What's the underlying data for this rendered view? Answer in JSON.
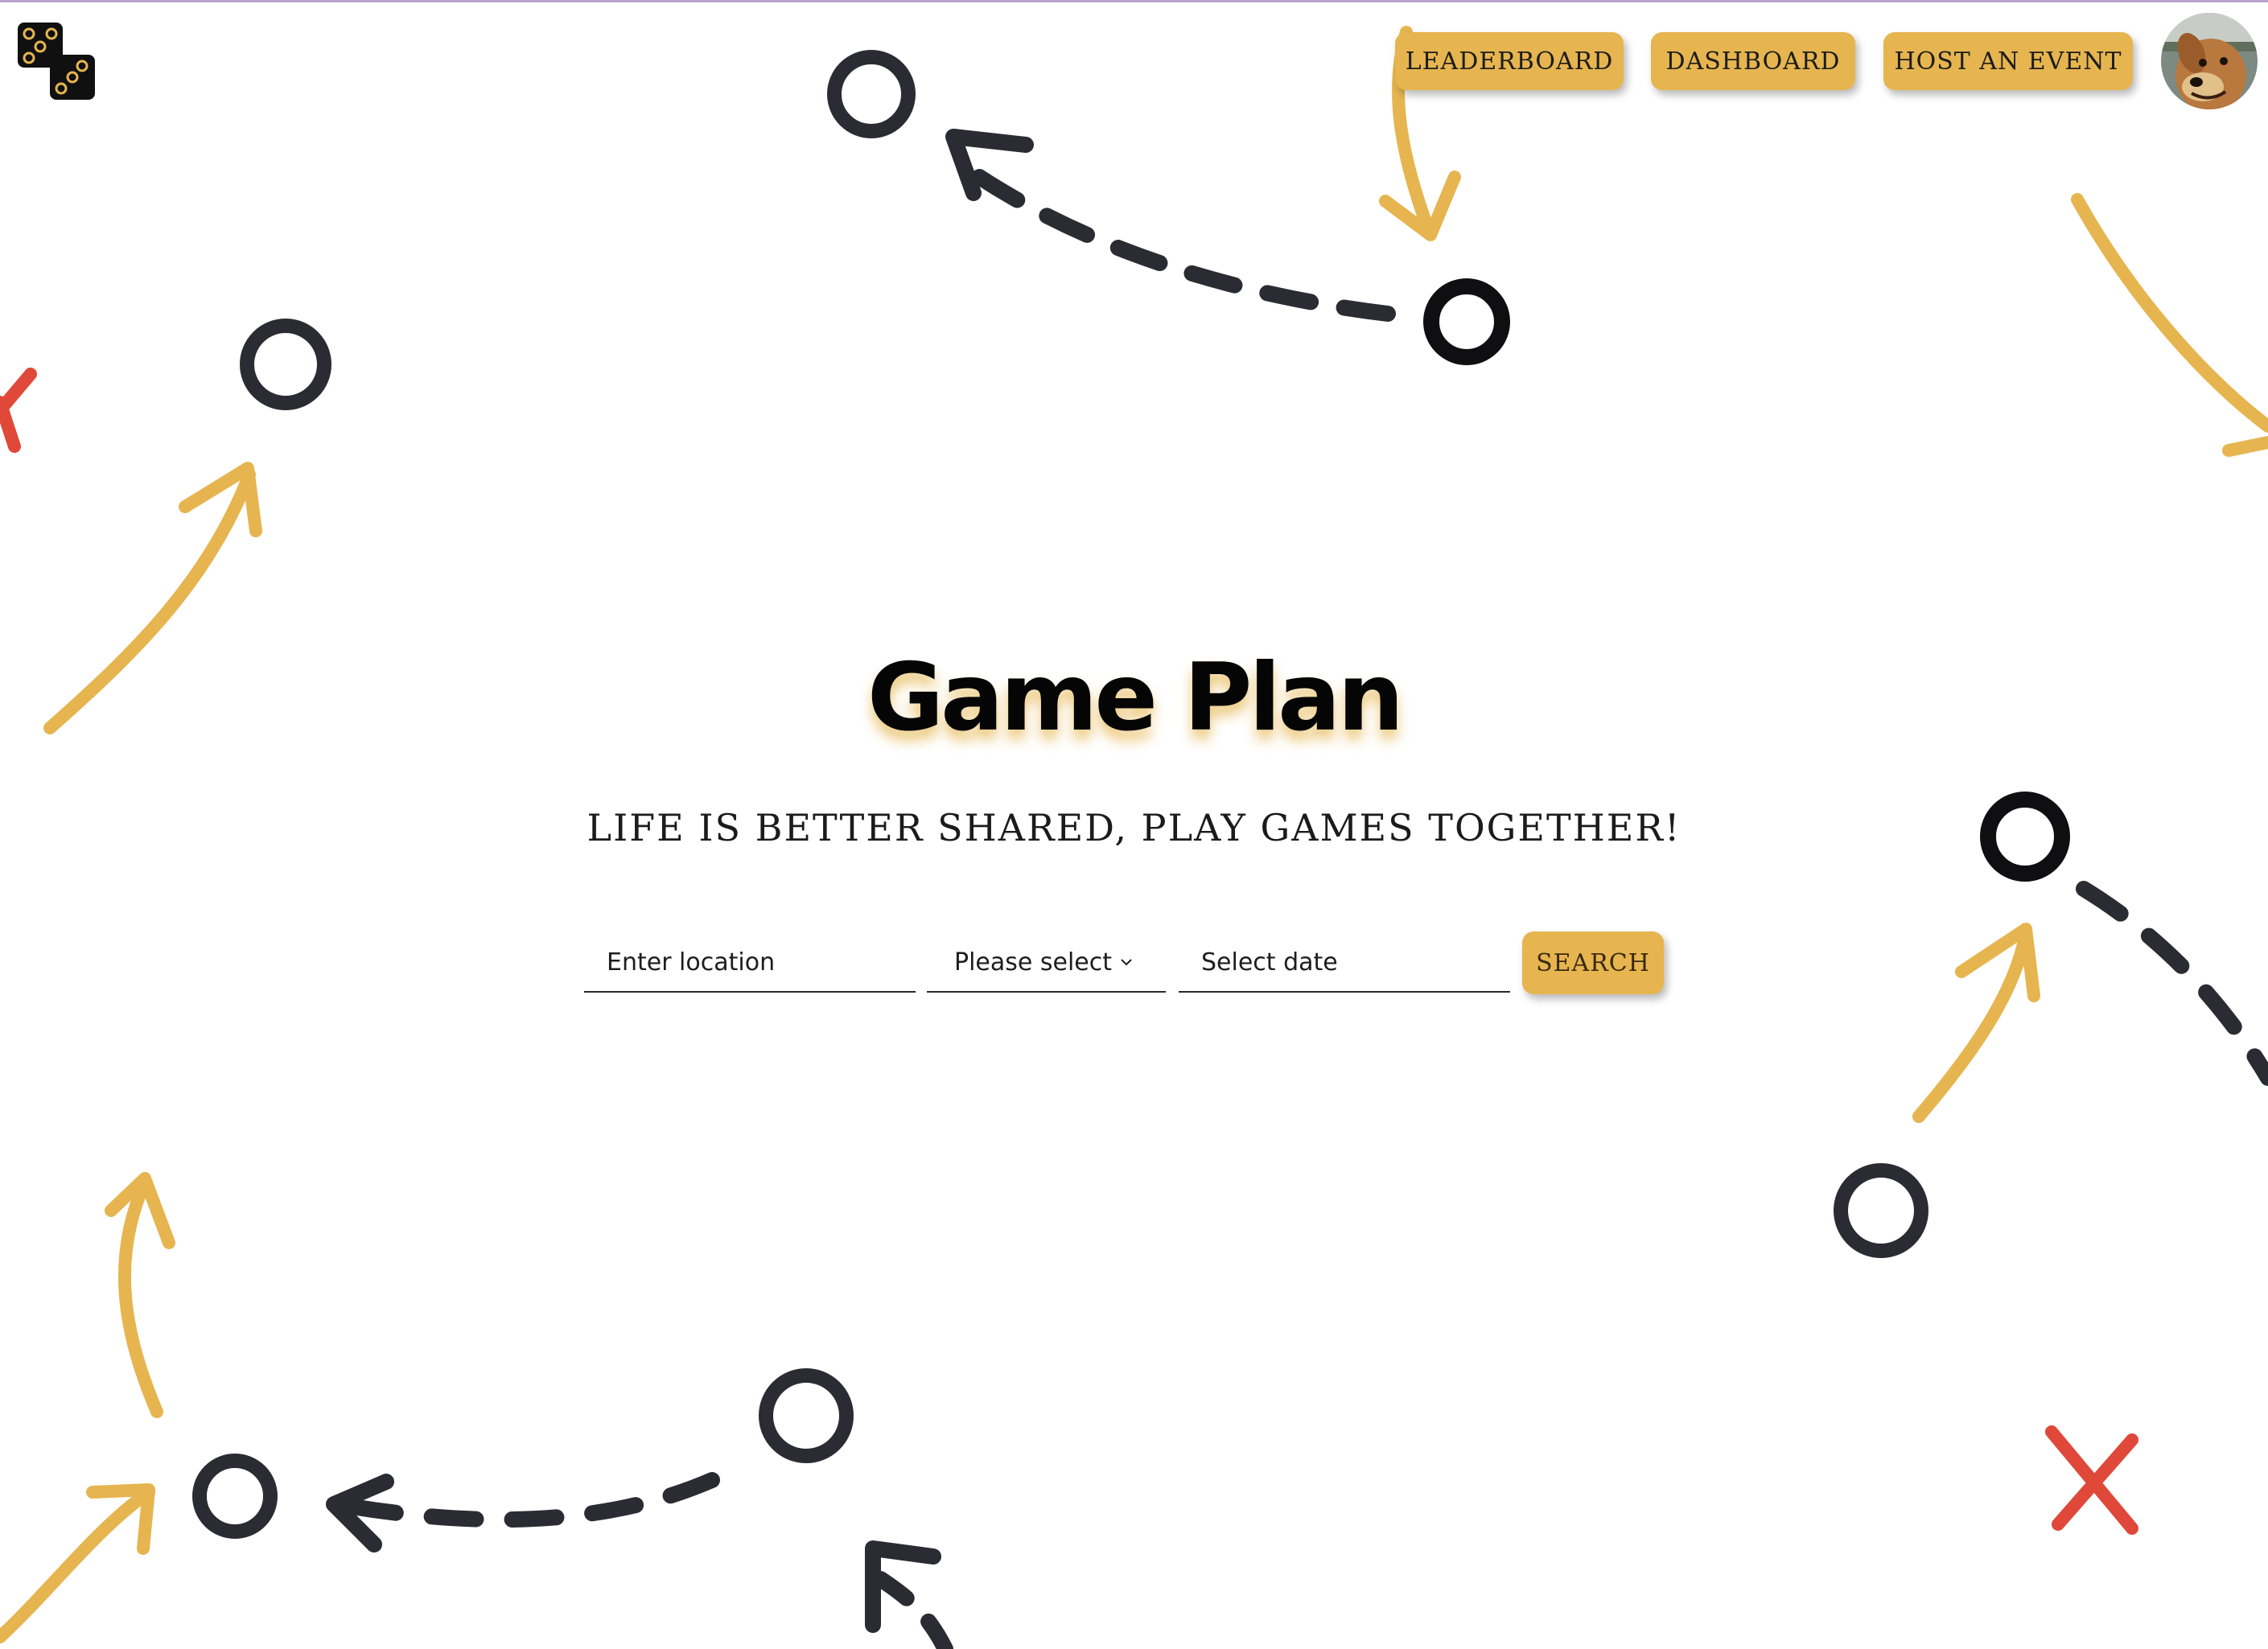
{
  "brand": {
    "logo_icon": "dice-icon"
  },
  "nav": {
    "leaderboard_label": "LEADERBOARD",
    "dashboard_label": "DASHBOARD",
    "host_label": "HOST AN EVENT"
  },
  "user": {
    "avatar_icon": "dog-avatar"
  },
  "hero": {
    "title": "Game Plan",
    "tagline": "LIFE IS BETTER SHARED, PLAY GAMES TOGETHER!"
  },
  "search": {
    "location_placeholder": "Enter location",
    "game_select_value": "Please select",
    "date_placeholder": "Select date",
    "button_label": "SEARCH"
  },
  "colors": {
    "accent": "#e6b54f",
    "ink": "#2b2b33",
    "red": "#e0483a",
    "background": "#ffffff"
  }
}
